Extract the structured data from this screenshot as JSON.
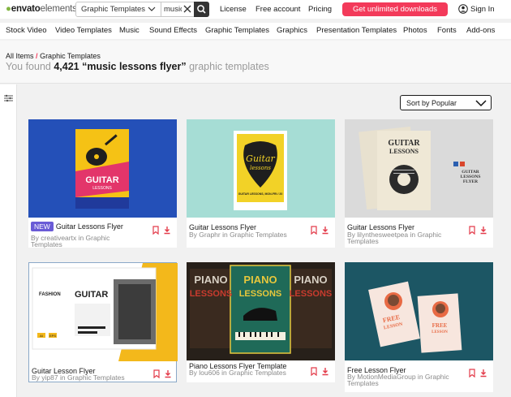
{
  "topbar": {
    "logo_word": "envato",
    "logo_word2": "elements",
    "search_category": "Graphic Templates",
    "search_value": "music",
    "links": [
      "License",
      "Free account",
      "Pricing"
    ],
    "cta_label": "Get unlimited downloads",
    "signin_label": "Sign In"
  },
  "catnav": [
    "Stock Video",
    "Video Templates",
    "Music",
    "Sound Effects",
    "Graphic Templates",
    "Graphics",
    "Presentation Templates",
    "Photos",
    "Fonts",
    "Add-ons"
  ],
  "header": {
    "crumb_root": "All Items",
    "crumb_sep": "/",
    "crumb_current": "Graphic Templates",
    "found_prefix": "You found",
    "found_count": "4,421 “music lessons flyer”",
    "found_suffix": "graphic templates"
  },
  "sort_label": "Sort by Popular",
  "cards": [
    {
      "badge": "NEW",
      "title": "Guitar Lessons Flyer",
      "by": "By creativeartx in Graphic Templates",
      "thumb_text": {
        "big": "GUITAR",
        "small": "LESSONS"
      },
      "colors": {
        "bg": "#2450b8",
        "poster": "#f5c215",
        "band": "#e3356a"
      }
    },
    {
      "badge": "",
      "title": "Guitar Lessons Flyer",
      "by": "By Graphr in Graphic Templates",
      "thumb_text": {
        "big": "Guitar",
        "small": "lessons",
        "note": "GUITAR LESSONS, MON-FRI / 20"
      },
      "colors": {
        "bg": "#a6ddd5",
        "poster": "#f2d227"
      }
    },
    {
      "badge": "",
      "title": "Guitar Lessons Flyer",
      "by": "By lilynthesweetpea in Graphic Templates",
      "thumb_text": {
        "big": "GUITAR",
        "small": "LESSONS",
        "side1": "GUITAR",
        "side2": "LESSONS",
        "side3": "FLYER"
      },
      "colors": {
        "bg": "#dadada",
        "poster": "#efe8d6"
      }
    },
    {
      "badge": "",
      "title": "Guitar Lesson Flyer",
      "by": "By yip87 in Graphic Templates",
      "thumb_text": {
        "big": "GUITAR",
        "small": "FASHION",
        "tag1": "AI",
        "tag2": "EPS"
      },
      "colors": {
        "bg": "#f3b81b",
        "poster": "#ffffff"
      }
    },
    {
      "badge": "",
      "title": "Piano Lessons Flyer Template",
      "by": "By lou606 in Graphic Templates",
      "thumb_text": {
        "big": "PIANO",
        "small": "LESSONS"
      },
      "colors": {
        "bg": "#27201a",
        "poster": "#1f6a58",
        "accent": "#e7c73c"
      }
    },
    {
      "badge": "",
      "title": "Free Lesson Flyer",
      "by": "By MotionMediaGroup in Graphic Templates",
      "thumb_text": {
        "big": "FREE",
        "small": "LESSON"
      },
      "colors": {
        "bg": "#1c5664",
        "poster": "#f7e6de",
        "accent": "#e86a44"
      }
    }
  ],
  "colors": {
    "cta": "#f33a5a",
    "brand_leaf": "#82b541",
    "badge": "#6a5bd6",
    "icon_red": "#e33b4a"
  },
  "icons": [
    "chevron-down-icon",
    "clear-icon",
    "search-icon",
    "account-icon",
    "filters-icon",
    "bookmark-icon",
    "download-icon"
  ]
}
